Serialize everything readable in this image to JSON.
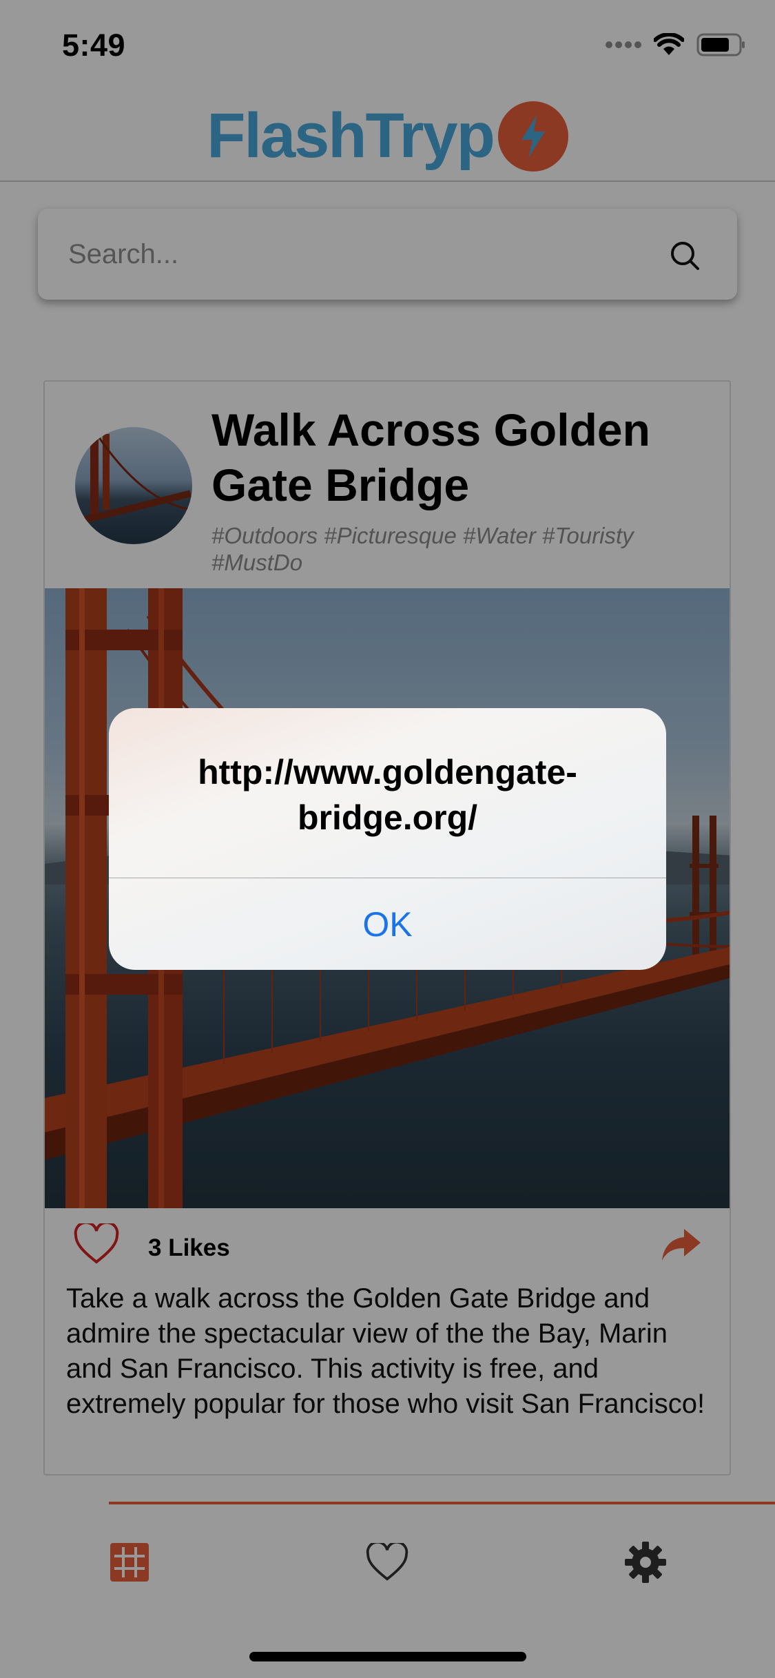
{
  "status_bar": {
    "time": "5:49"
  },
  "header": {
    "brand": "FlashTryp"
  },
  "search": {
    "placeholder": "Search..."
  },
  "card": {
    "title": "Walk Across Golden Gate Bridge",
    "tags": "#Outdoors #Picturesque #Water #Touristy #MustDo",
    "likes": "3 Likes",
    "description": "Take a walk across the Golden Gate Bridge and admire the spectacular view of the the Bay, Marin and San Francisco. This activity is free, and extremely popular for those who visit San Francisco!"
  },
  "alert": {
    "message": "http://www.goldengate-bridge.org/",
    "ok_label": "OK"
  },
  "tabs": [
    {
      "name": "Feed",
      "icon": "grid-icon",
      "active": true
    },
    {
      "name": "Favorites",
      "icon": "heart-icon",
      "active": false
    },
    {
      "name": "Settings",
      "icon": "gear-icon",
      "active": false
    }
  ],
  "colors": {
    "brand_blue": "#4aa9dc",
    "accent_orange": "#e9603c",
    "ios_link_blue": "#1a73e8",
    "like_red": "#d62020"
  }
}
